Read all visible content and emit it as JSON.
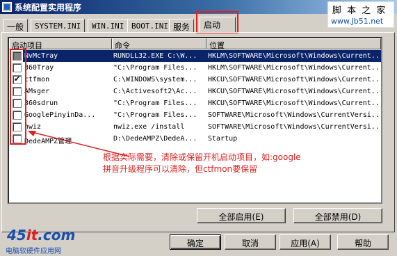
{
  "window": {
    "title": "系统配置实用程序"
  },
  "watermark_top": {
    "title": "脚 本 之 家",
    "url": "www.Jb51.net"
  },
  "tabs": [
    {
      "label": "一般"
    },
    {
      "label": "SYSTEM.INI"
    },
    {
      "label": "WIN.INI"
    },
    {
      "label": "BOOT.INI"
    },
    {
      "label": "服务"
    },
    {
      "label": "启动",
      "active": true
    }
  ],
  "columns": [
    "启动项目",
    "命令",
    "位置"
  ],
  "rows": [
    {
      "checked": "filled",
      "item": "NvMcTray",
      "command": "RUNDLL32.EXE C:\\W...",
      "location": "HKLM\\SOFTWARE\\Microsoft\\Windows\\Current...",
      "selected": true
    },
    {
      "checked": "unchecked",
      "item": "360Tray",
      "command": "\"C:\\Program Files...",
      "location": "HKLM\\SOFTWARE\\Microsoft\\Windows\\Current..."
    },
    {
      "checked": "checked",
      "item": "ctfmon",
      "command": "C:\\WINDOWS\\system...",
      "location": "HKCU\\SOFTWARE\\Microsoft\\Windows\\Current..."
    },
    {
      "checked": "unchecked",
      "item": "AMsger",
      "command": "C:\\Activesoft2\\Ac...",
      "location": "HKCU\\SOFTWARE\\Microsoft\\Windows\\Current..."
    },
    {
      "checked": "unchecked",
      "item": "360sdrun",
      "command": "\"C:\\Program Files...",
      "location": "HKCU\\SOFTWARE\\Microsoft\\Windows\\Current..."
    },
    {
      "checked": "unchecked",
      "item": "GooglePinyinDa...",
      "command": "\"C:\\Program Files...",
      "location": "SOFTWARE\\Microsoft\\Windows\\CurrentVersi..."
    },
    {
      "checked": "unchecked",
      "item": "nwiz",
      "command": "nwiz.exe /install",
      "location": "SOFTWARE\\Microsoft\\Windows\\CurrentVersi..."
    },
    {
      "checked": "unchecked",
      "item": "DedeAMPZ管理",
      "command": "D:\\DedeAMPZ\\DedeA...",
      "location": "Startup"
    }
  ],
  "annotation": {
    "line1": "根据实际需要，清除或保留开机启动项目，如:google",
    "line2": "拼音升级程序可以清除，但ctfmon要保留"
  },
  "buttons": {
    "enable_all": "全部启用(E)",
    "disable_all": "全部禁用(D)",
    "ok": "确定",
    "cancel": "取消",
    "apply": "应用(A)",
    "help": "帮助"
  },
  "watermark_bottom": {
    "logo_a": "45",
    "logo_b": "it",
    "logo_c": ".com",
    "subtitle": "电脑软硬件应用网"
  },
  "colors": {
    "highlight_red": "#e02020",
    "selection": "#0a246a",
    "title_bar": "#0a246a"
  }
}
